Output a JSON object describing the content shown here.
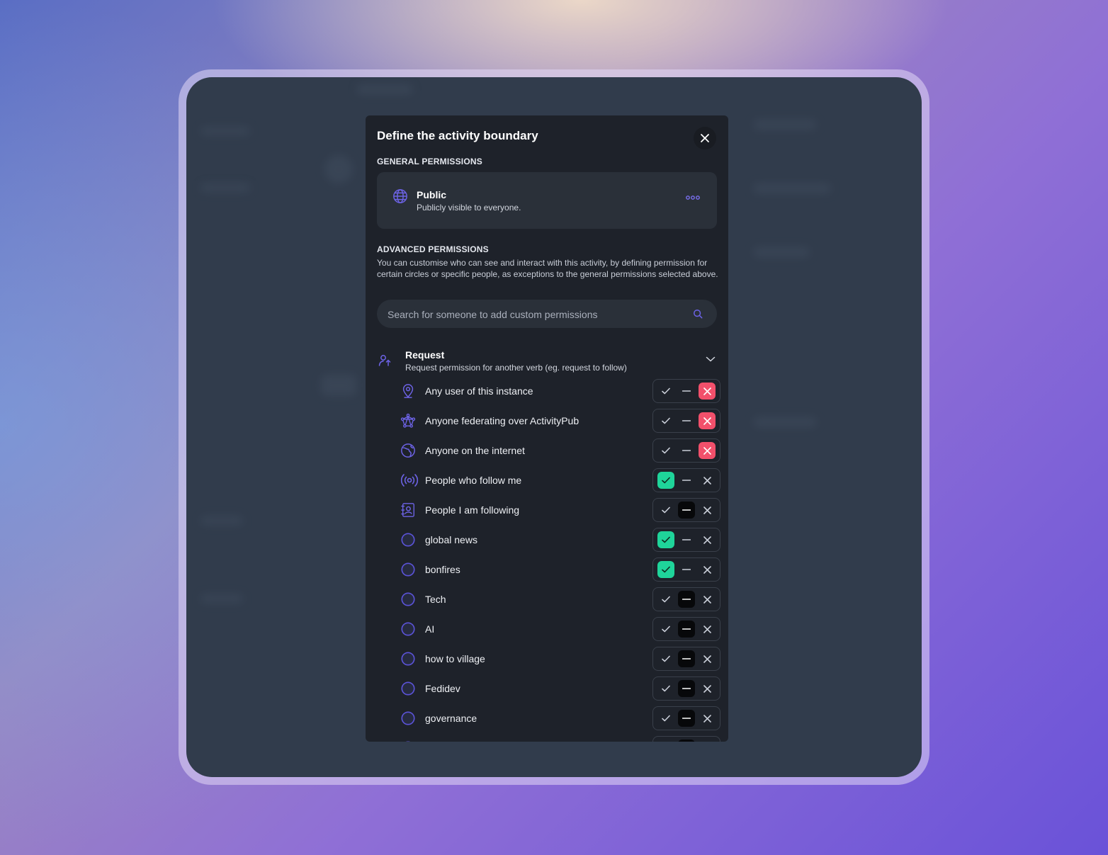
{
  "modal": {
    "title": "Define the activity boundary",
    "general_label": "GENERAL PERMISSIONS",
    "public": {
      "title": "Public",
      "subtitle": "Publicly visible to everyone."
    },
    "advanced_label": "ADVANCED PERMISSIONS",
    "advanced_desc": "You can customise who can see and interact with this activity, by defining permission for certain circles or specific people, as exceptions to the general permissions selected above.",
    "search_placeholder": "Search for someone to add custom permissions",
    "verb": {
      "title": "Request",
      "subtitle": "Request permission for another verb (eg. request to follow)"
    },
    "rows": [
      {
        "label": "Any user of this instance",
        "icon": "location-pin-icon",
        "state": "no"
      },
      {
        "label": "Anyone federating over ActivityPub",
        "icon": "federation-icon",
        "state": "no"
      },
      {
        "label": "Anyone on the internet",
        "icon": "internet-globe-icon",
        "state": "no"
      },
      {
        "label": "People who follow me",
        "icon": "broadcast-icon",
        "state": "yes"
      },
      {
        "label": "People I am following",
        "icon": "contact-book-icon",
        "state": "default"
      },
      {
        "label": "global news",
        "icon": "circle-icon",
        "state": "yes"
      },
      {
        "label": "bonfires",
        "icon": "circle-icon",
        "state": "yes"
      },
      {
        "label": "Tech",
        "icon": "circle-icon",
        "state": "default"
      },
      {
        "label": "AI",
        "icon": "circle-icon",
        "state": "default"
      },
      {
        "label": "how to village",
        "icon": "circle-icon",
        "state": "default"
      },
      {
        "label": "Fedidev",
        "icon": "circle-icon",
        "state": "default"
      },
      {
        "label": "governance",
        "icon": "circle-icon",
        "state": "default"
      },
      {
        "label": "",
        "icon": "circle-icon",
        "state": "default"
      }
    ]
  },
  "colors": {
    "accent": "#6d63e6",
    "allow": "#1fd49a",
    "deny": "#f2506b",
    "default": "#07080a",
    "modal_bg": "#1e222a"
  }
}
